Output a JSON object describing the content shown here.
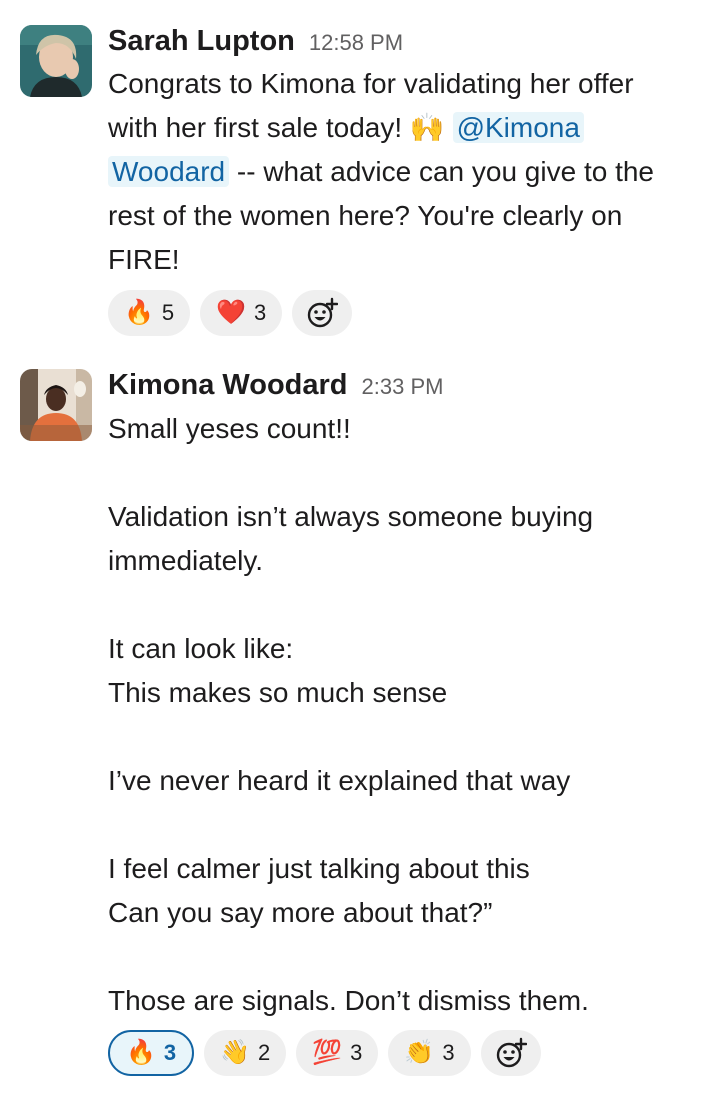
{
  "messages": [
    {
      "author": "Sarah Lupton",
      "time": "12:58 PM",
      "text_a": "Congrats to Kimona for validating her offer",
      "text_b": "with her first sale today! ",
      "emoji_inline": "🙌",
      "mention_a": "@Kimona",
      "mention_b": "Woodard",
      "text_c": " -- what advice can you give to the",
      "text_d": "rest of the women here? You're clearly on",
      "text_e": "FIRE!",
      "reactions": [
        {
          "emoji": "🔥",
          "count": "5"
        },
        {
          "emoji": "❤️",
          "count": "3"
        }
      ]
    },
    {
      "author": "Kimona Woodard",
      "time": "2:33 PM",
      "lines": [
        "Small yeses count!!",
        "",
        "Validation isn’t always someone buying",
        "immediately.",
        "",
        "It can look like:",
        "This makes so much sense",
        "",
        "I’ve never heard it explained that way",
        "",
        "I feel calmer just talking about this",
        "Can you say more about that?”",
        "",
        "Those are signals. Don’t dismiss them."
      ],
      "reactions": [
        {
          "emoji": "🔥",
          "count": "3",
          "active": true
        },
        {
          "emoji": "👋",
          "count": "2"
        },
        {
          "emoji": "💯",
          "count": "3"
        },
        {
          "emoji": "👏",
          "count": "3"
        }
      ]
    }
  ],
  "icons": {
    "add_reaction": "add-reaction-icon"
  },
  "colors": {
    "mention": "#1264a3",
    "mention_bg": "#e8f5fa",
    "reaction_bg": "#efefef",
    "timestamp": "#616061"
  }
}
